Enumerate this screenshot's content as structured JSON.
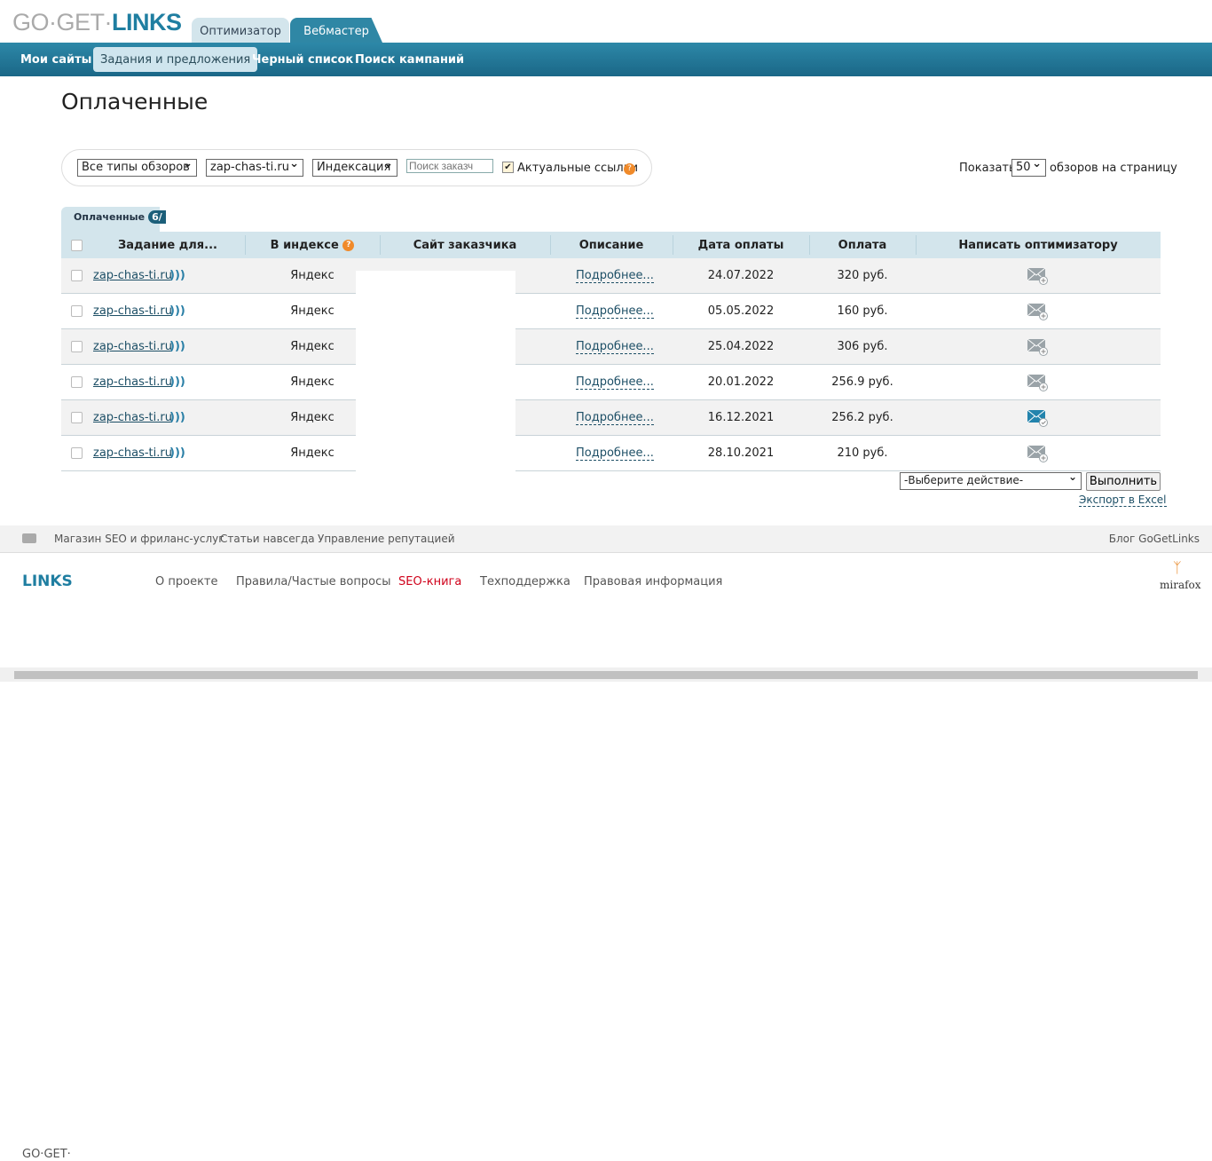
{
  "logo": {
    "part1": "GO·GET·",
    "part2": "LINKS"
  },
  "top_tabs": [
    "Оптимизатор",
    "Вебмастер"
  ],
  "nav": [
    "Мои сайты",
    "Задания и предложения",
    "Черный список",
    "Поиск кампаний"
  ],
  "page_title": "Оплаченные",
  "filters": {
    "type": "Все типы обзоров",
    "site": "zap-chas-ti.ru",
    "index": "Индексация",
    "search_placeholder": "Поиск заказч",
    "actual_label": "Актуальные ссылки",
    "actual_checked": true
  },
  "per_page": {
    "prefix": "Показать",
    "value": "50",
    "suffix": "обзоров на страницу"
  },
  "tab": {
    "label": "Оплаченные",
    "count": "6/"
  },
  "columns": [
    "Задание для...",
    "В индексе",
    "Сайт заказчика",
    "Описание",
    "Дата оплаты",
    "Оплата",
    "Написать оптимизатору"
  ],
  "rows": [
    {
      "site": "zap-chas-ti.ru",
      "index": "Яндекс",
      "desc": "Подробнее...",
      "date": "24.07.2022",
      "pay": "320 руб.",
      "msg_state": "new"
    },
    {
      "site": "zap-chas-ti.ru",
      "index": "Яндекс",
      "desc": "Подробнее...",
      "date": "05.05.2022",
      "pay": "160 руб.",
      "msg_state": "new"
    },
    {
      "site": "zap-chas-ti.ru",
      "index": "Яндекс",
      "desc": "Подробнее...",
      "date": "25.04.2022",
      "pay": "306 руб.",
      "msg_state": "new"
    },
    {
      "site": "zap-chas-ti.ru",
      "index": "Яндекс",
      "desc": "Подробнее...",
      "date": "20.01.2022",
      "pay": "256.9 руб.",
      "msg_state": "new"
    },
    {
      "site": "zap-chas-ti.ru",
      "index": "Яндекс",
      "desc": "Подробнее...",
      "date": "16.12.2021",
      "pay": "256.2 руб.",
      "msg_state": "sent"
    },
    {
      "site": "zap-chas-ti.ru",
      "index": "Яндекс",
      "desc": "Подробнее...",
      "date": "28.10.2021",
      "pay": "210 руб.",
      "msg_state": "new"
    }
  ],
  "actions": {
    "select": "-Выберите действие-",
    "run": "Выполнить",
    "export": "Экспорт в Excel"
  },
  "footer_top": [
    "Магазин SEO и фриланс-услуг",
    "Статьи навсегда",
    "Управление репутацией"
  ],
  "footer_blog": "Блог GoGetLinks",
  "footer_links": [
    "О проекте",
    "Правила/Частые вопросы",
    "SEO-книга",
    "Техподдержка",
    "Правовая информация"
  ],
  "mirafox": "mirafox",
  "colors": {
    "brand": "#1f7ea1",
    "header_bg": "#d3e5ec",
    "seo_book": "#d0021b"
  }
}
